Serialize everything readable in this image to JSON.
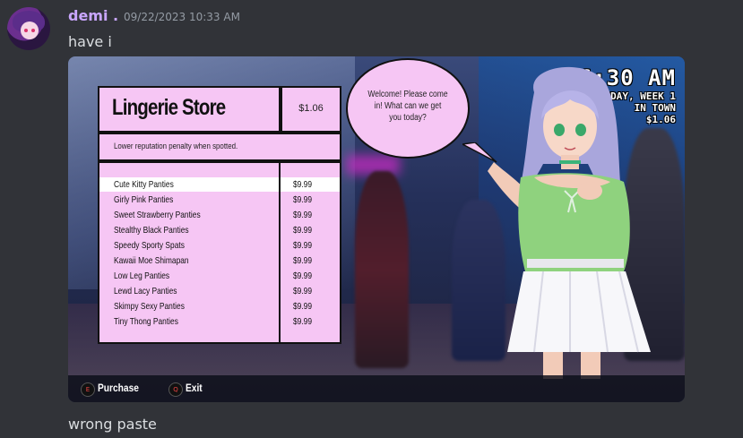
{
  "message": {
    "username": "demi .",
    "timestamp": "09/22/2023 10:33 AM",
    "text_before": "have i",
    "text_after": "wrong paste"
  },
  "game": {
    "store_title": "Lingerie Store",
    "money": "$1.06",
    "description": "Lower reputation penalty when spotted.",
    "items": [
      {
        "name": "Cute Kitty Panties",
        "price": "$9.99",
        "selected": true
      },
      {
        "name": "Girly Pink Panties",
        "price": "$9.99"
      },
      {
        "name": "Sweet Strawberry Panties",
        "price": "$9.99"
      },
      {
        "name": "Stealthy Black Panties",
        "price": "$9.99"
      },
      {
        "name": "Speedy Sporty Spats",
        "price": "$9.99"
      },
      {
        "name": "Kawaii Moe Shimapan",
        "price": "$9.99"
      },
      {
        "name": "Low Leg Panties",
        "price": "$9.99"
      },
      {
        "name": "Lewd Lacy Panties",
        "price": "$9.99"
      },
      {
        "name": "Skimpy Sexy Panties",
        "price": "$9.99"
      },
      {
        "name": "Tiny Thong Panties",
        "price": "$9.99"
      }
    ],
    "speech": "Welcome! Please come in! What can we get you today?",
    "hud": {
      "time": "6:30 AM",
      "day": "TUESDAY, WEEK 1",
      "location": "IN TOWN",
      "money": "$1.06"
    },
    "controls": [
      {
        "key": "E",
        "label": "Purchase"
      },
      {
        "key": "Q",
        "label": "Exit"
      }
    ]
  },
  "colors": {
    "background": "#313338",
    "username": "#c9a6ff",
    "panel": "#f6c6f4"
  }
}
